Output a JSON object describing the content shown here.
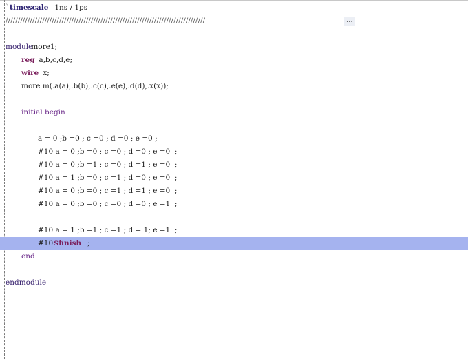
{
  "editor": {
    "lines": [
      {
        "kind": "timescale",
        "tick": "`",
        "directive": "timescale",
        "rest": " 1ns / 1ps"
      },
      {
        "kind": "comment",
        "text": "//////////////////////////////////////////////////////////////////////////////////",
        "fold": "..."
      },
      {
        "kind": "blank"
      },
      {
        "kind": "module",
        "kw": "module",
        "name": " more1;"
      },
      {
        "kind": "decl",
        "kw": "reg",
        "rest": " a,b,c,d,e;"
      },
      {
        "kind": "decl",
        "kw": "wire",
        "rest": " x;"
      },
      {
        "kind": "plain",
        "text": "more m(.a(a),.b(b),.c(c),.e(e),.d(d),.x(x));"
      },
      {
        "kind": "blank"
      },
      {
        "kind": "initial",
        "text": "initial begin"
      },
      {
        "kind": "blank"
      },
      {
        "kind": "plain2",
        "text": "a = 0 ;b =0 ; c =0 ; d =0 ; e =0 ;"
      },
      {
        "kind": "plain2",
        "text": "#10 a = 0 ;b =0 ; c =0 ; d =0 ; e =0  ;"
      },
      {
        "kind": "plain2",
        "text": "#10 a = 0 ;b =1 ; c =0 ; d =1 ; e =0  ;"
      },
      {
        "kind": "plain2",
        "text": "#10 a = 1 ;b =0 ; c =1 ; d =0 ; e =0  ;"
      },
      {
        "kind": "plain2",
        "text": "#10 a = 0 ;b =0 ; c =1 ; d =1 ; e =0  ;"
      },
      {
        "kind": "plain2",
        "text": "#10 a = 0 ;b =0 ; c =0 ; d =0 ; e =1  ;"
      },
      {
        "kind": "blank"
      },
      {
        "kind": "plain2",
        "text": "#10 a = 1 ;b =1 ; c =1 ; d = 1; e =1  ;"
      },
      {
        "kind": "finish",
        "pre": "#10 ",
        "sys": "$finish",
        "post": ";"
      },
      {
        "kind": "end",
        "text": "end"
      },
      {
        "kind": "blank"
      },
      {
        "kind": "endmodule",
        "text": "endmodule"
      }
    ]
  },
  "colors": {
    "highlight": "#a5b3ef",
    "keyword": "#7a1f5c",
    "directive": "#2d2473"
  }
}
